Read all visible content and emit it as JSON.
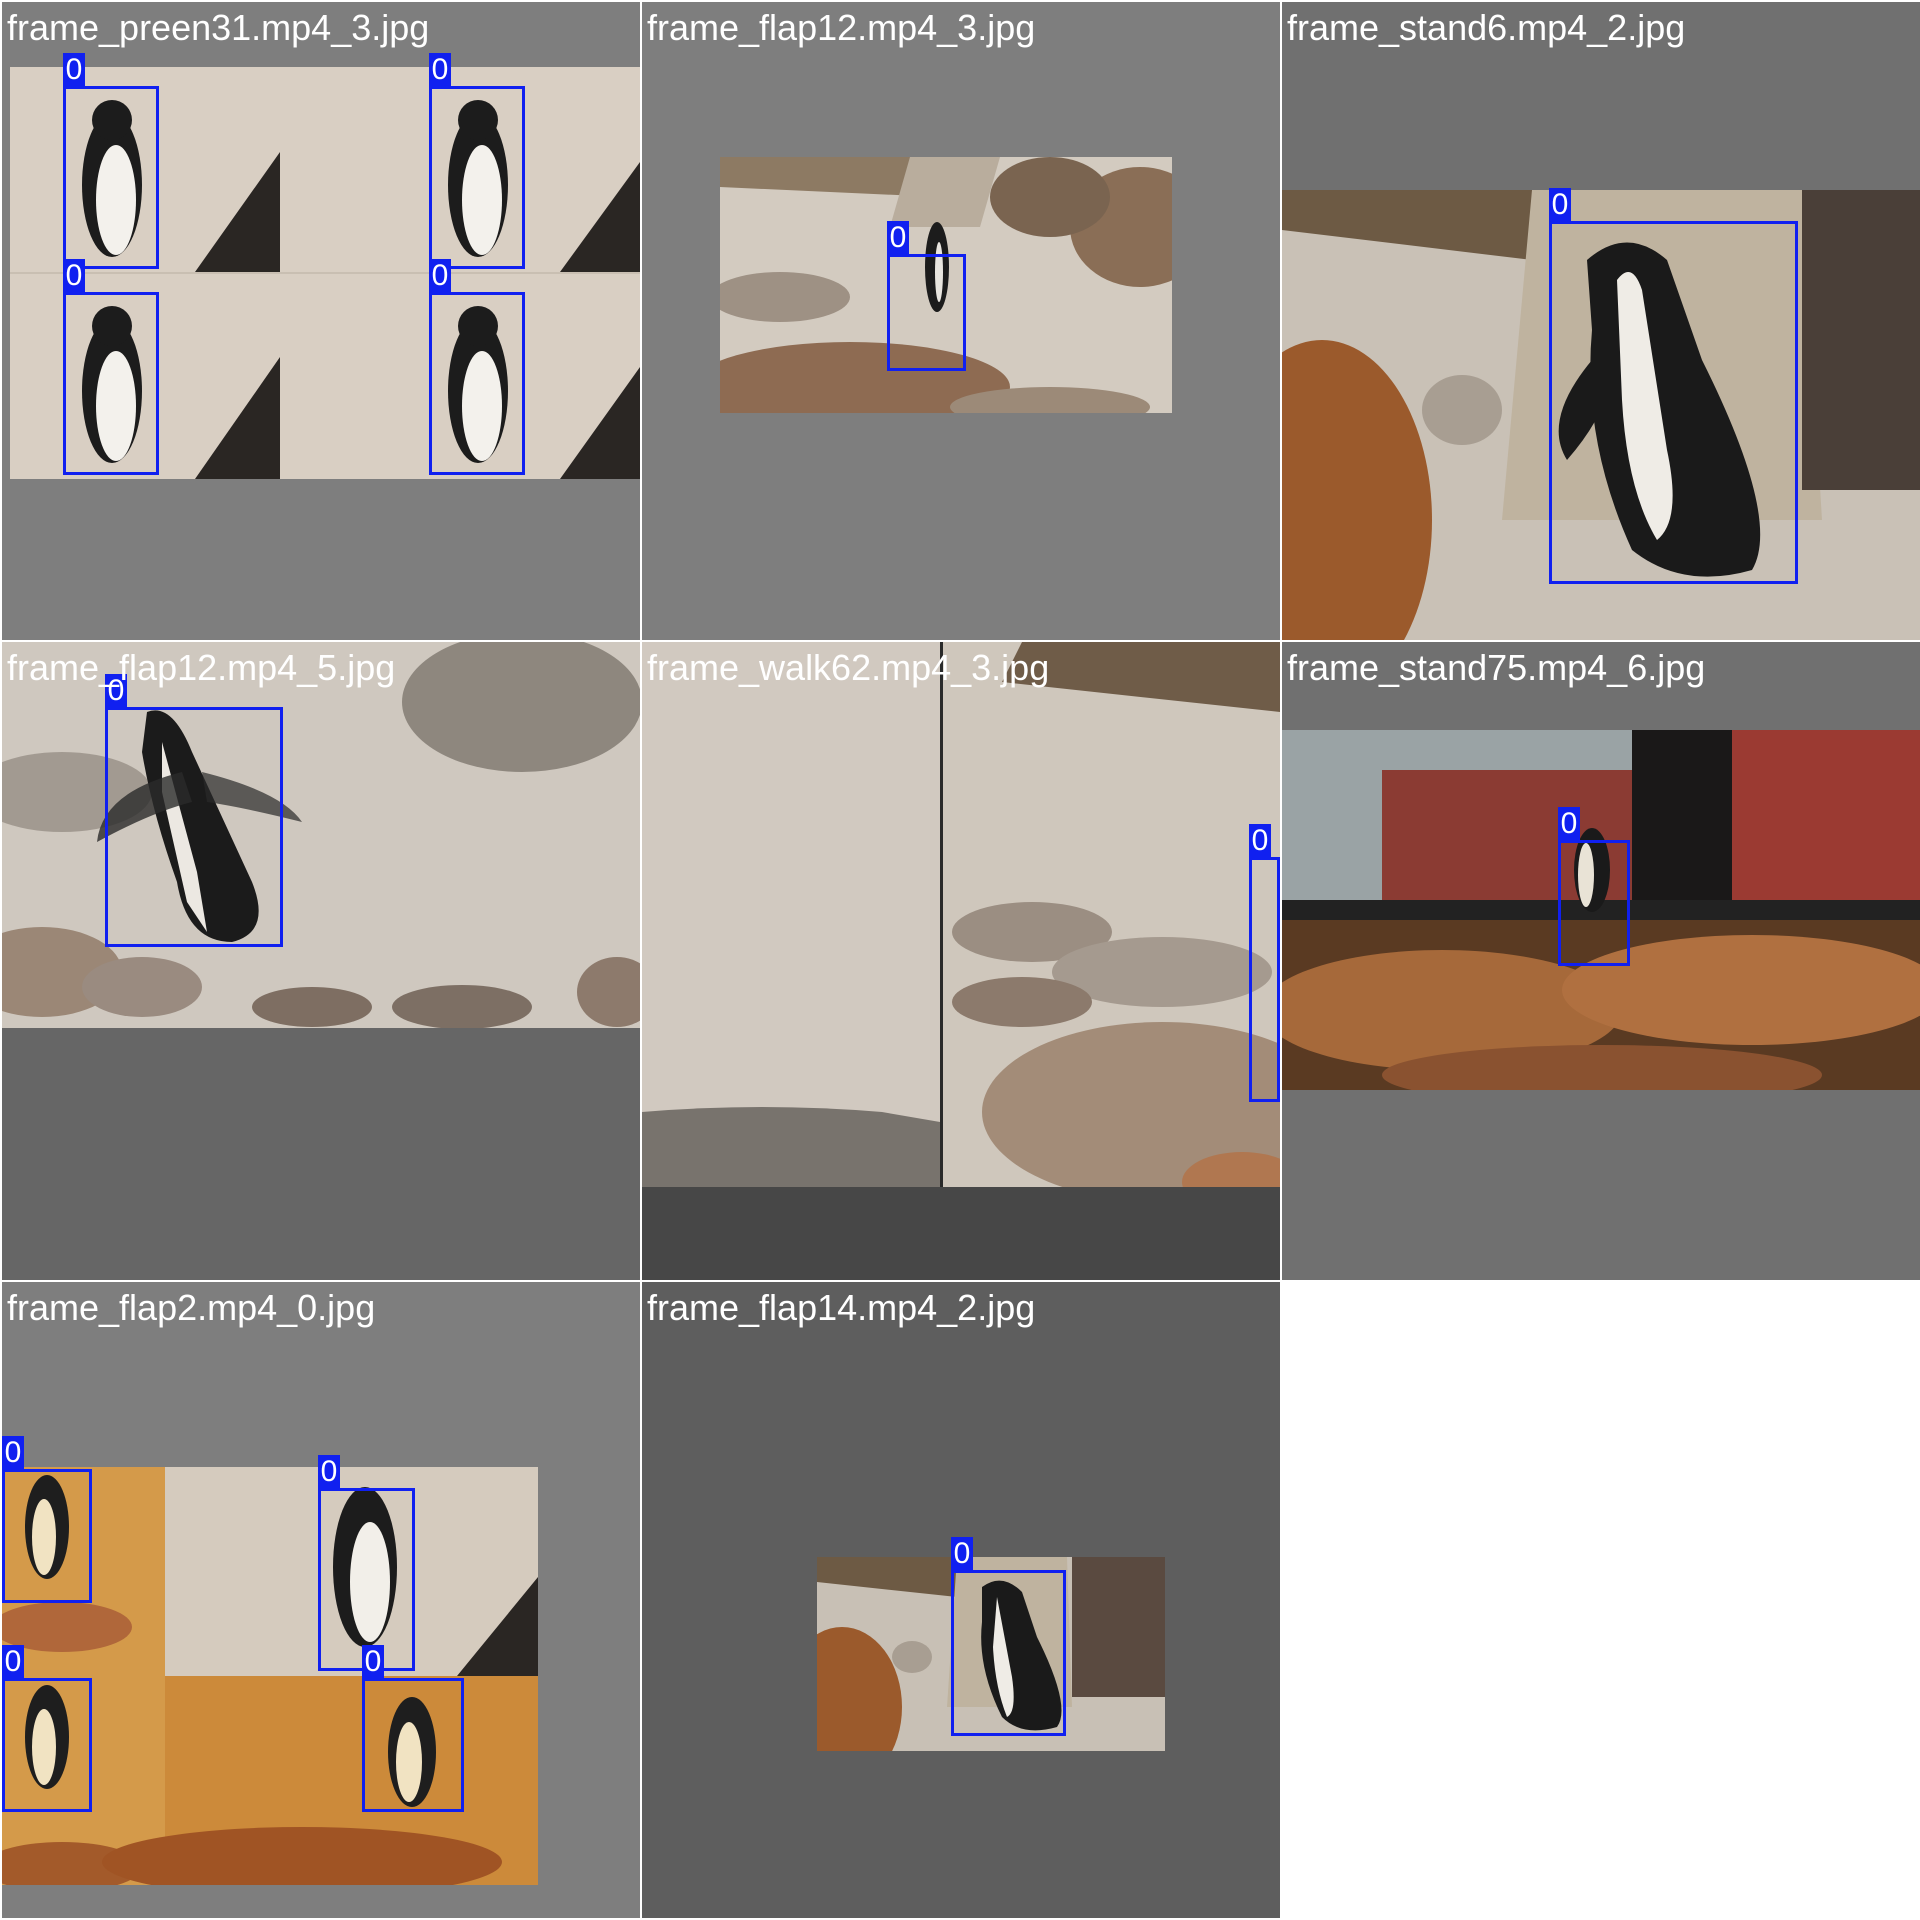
{
  "tiles": [
    {
      "caption": "frame_preen31.mp4_3.jpg",
      "labels": [
        "0",
        "0",
        "0",
        "0"
      ]
    },
    {
      "caption": "frame_flap12.mp4_3.jpg",
      "labels": [
        "0"
      ]
    },
    {
      "caption": "frame_stand6.mp4_2.jpg",
      "labels": [
        "0"
      ]
    },
    {
      "caption": "frame_flap12.mp4_5.jpg",
      "labels": [
        "0"
      ]
    },
    {
      "caption": "frame_walk62.mp4_3.jpg",
      "labels": [
        "0"
      ]
    },
    {
      "caption": "frame_stand75.mp4_6.jpg",
      "labels": [
        "0"
      ]
    },
    {
      "caption": "frame_flap2.mp4_0.jpg",
      "labels": [
        "0",
        "0",
        "0",
        "0"
      ]
    },
    {
      "caption": "frame_flap14.mp4_2.jpg",
      "labels": [
        "0"
      ]
    }
  ],
  "colors": {
    "bbox": "#1020f0",
    "caption_text": "#ffffff",
    "tile_border": "#ffffff"
  }
}
